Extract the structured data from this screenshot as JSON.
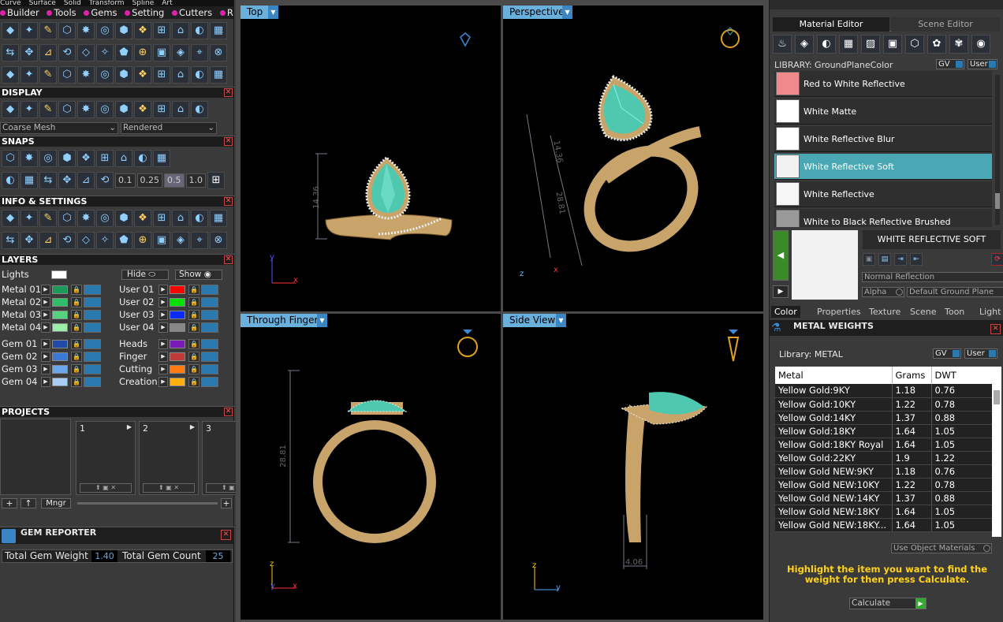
{
  "menu": {
    "top_items": [
      "Curve",
      "Surface",
      "Solid",
      "Transform",
      "Spline",
      "Art"
    ],
    "items": [
      "Builder",
      "Tools",
      "Gems",
      "Setting",
      "Cutters",
      "Render"
    ]
  },
  "display": {
    "title": "DISPLAY",
    "mesh": "Coarse Mesh",
    "render": "Rendered"
  },
  "snaps": {
    "title": "SNAPS",
    "values": [
      "0.1",
      "0.25",
      "0.5",
      "1.0"
    ]
  },
  "info": {
    "title": "INFO & SETTINGS"
  },
  "layers": {
    "title": "LAYERS",
    "lights": "Lights",
    "hide": "Hide",
    "show": "Show",
    "left": [
      {
        "name": "Metal 01",
        "color": "#1a9a5a"
      },
      {
        "name": "Metal 02",
        "color": "#2fbd6a"
      },
      {
        "name": "Metal 03",
        "color": "#55d27e"
      },
      {
        "name": "Metal 04",
        "color": "#9aeea8"
      },
      {
        "name": "Gem 01",
        "color": "#1f4aa8"
      },
      {
        "name": "Gem 02",
        "color": "#3a7ad4"
      },
      {
        "name": "Gem 03",
        "color": "#6aa6ec"
      },
      {
        "name": "Gem 04",
        "color": "#a8cef6"
      }
    ],
    "right": [
      {
        "name": "User 01",
        "color": "#ff0000"
      },
      {
        "name": "User 02",
        "color": "#00e000"
      },
      {
        "name": "User 03",
        "color": "#0a2aff"
      },
      {
        "name": "User 04",
        "color": "#888888"
      },
      {
        "name": "Heads",
        "color": "#7a1ab8"
      },
      {
        "name": "Finger",
        "color": "#c03a3a"
      },
      {
        "name": "Cutting",
        "color": "#ff7a10"
      },
      {
        "name": "Creation",
        "color": "#ffb010"
      }
    ]
  },
  "projects": {
    "title": "PROJECTS",
    "slots": [
      "1",
      "2",
      "3"
    ],
    "mngr": "Mngr"
  },
  "gem_reporter": {
    "title": "GEM REPORTER",
    "weight_label": "Total Gem Weight",
    "weight": "1.40",
    "count_label": "Total Gem Count",
    "count": "25"
  },
  "viewports": {
    "top": "Top",
    "perspective": "Perspective",
    "through_finger": "Through Finger",
    "side": "Side View"
  },
  "dims": {
    "top_h": "14.36",
    "persp_a": "14.36",
    "persp_b": "28.81",
    "finger_h": "28.81",
    "side_w": "4.06"
  },
  "axes": {
    "x": "x",
    "y": "y",
    "z": "z"
  },
  "material_editor": {
    "tab1": "Material Editor",
    "tab2": "Scene Editor",
    "library_label": "LIBRARY: GroundPlaneColor",
    "gv": "GV",
    "user": "User",
    "materials": [
      {
        "name": "Red to White Reflective",
        "swatch": "#f08a8a"
      },
      {
        "name": "White Matte",
        "swatch": "#ffffff"
      },
      {
        "name": "White Reflective Blur",
        "swatch": "#ffffff"
      },
      {
        "name": "White Reflective Soft",
        "swatch": "#f2f2f2"
      },
      {
        "name": "White Reflective",
        "swatch": "#f6f6f6"
      },
      {
        "name": "White to Black Reflective Brushed",
        "swatch": "#9a9a9a"
      }
    ],
    "selected_title": "WHITE REFLECTIVE SOFT",
    "reflection": "Normal Reflection",
    "alpha": "Alpha",
    "ground": "Default Ground Plane",
    "bottom_tabs": [
      "Color",
      "Properties",
      "Texture",
      "Scene",
      "Toon",
      "Light"
    ]
  },
  "metal_weights": {
    "title": "METAL WEIGHTS",
    "library": "Library: METAL",
    "gv": "GV",
    "user": "User",
    "headers": [
      "Metal",
      "Grams",
      "DWT"
    ],
    "rows": [
      [
        "Yellow Gold:9KY",
        "1.18",
        "0.76"
      ],
      [
        "Yellow Gold:10KY",
        "1.22",
        "0.78"
      ],
      [
        "Yellow Gold:14KY",
        "1.37",
        "0.88"
      ],
      [
        "Yellow Gold:18KY",
        "1.64",
        "1.05"
      ],
      [
        "Yellow Gold:18KY Royal",
        "1.64",
        "1.05"
      ],
      [
        "Yellow Gold:22KY",
        "1.9",
        "1.22"
      ],
      [
        "Yellow Gold NEW:9KY",
        "1.18",
        "0.76"
      ],
      [
        "Yellow Gold NEW:10KY",
        "1.22",
        "0.78"
      ],
      [
        "Yellow Gold NEW:14KY",
        "1.37",
        "0.88"
      ],
      [
        "Yellow Gold NEW:18KY",
        "1.64",
        "1.05"
      ],
      [
        "Yellow Gold NEW:18KY...",
        "1.64",
        "1.05"
      ]
    ],
    "use_object": "Use Object Materials",
    "hint": "Highlight the item you want to find the weight for then press Calculate.",
    "calculate": "Calculate"
  }
}
